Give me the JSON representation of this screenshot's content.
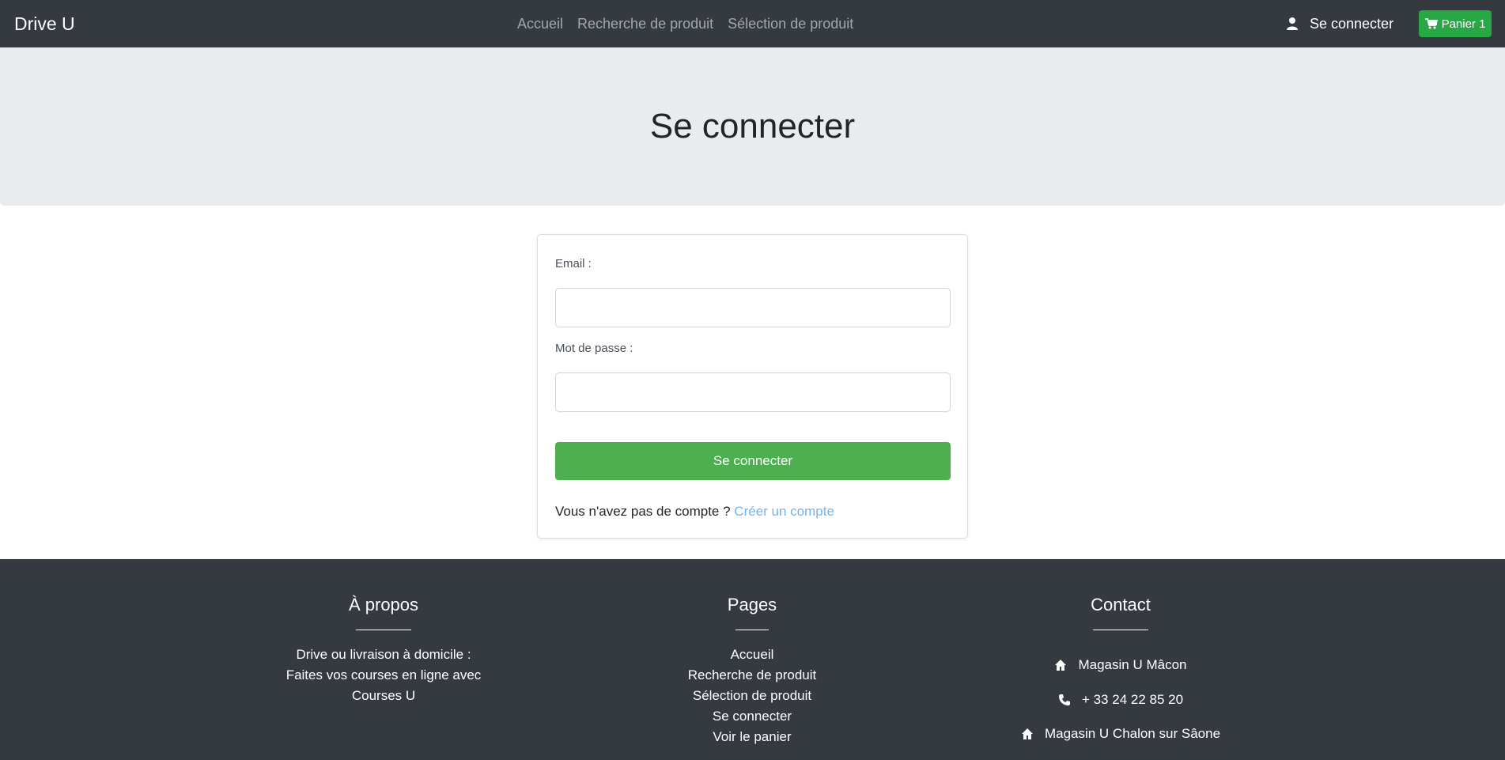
{
  "navbar": {
    "brand": "Drive U",
    "links": [
      "Accueil",
      "Recherche de produit",
      "Sélection de produit"
    ],
    "login_label": "Se connecter",
    "cart_label": "Panier 1"
  },
  "hero": {
    "title": "Se connecter"
  },
  "login_form": {
    "email_label": "Email :",
    "email_value": "",
    "password_label": "Mot de passe :",
    "password_value": "",
    "submit_label": "Se connecter",
    "register_prompt": "Vous n'avez pas de compte ?",
    "register_link": "Créer un compte"
  },
  "footer": {
    "about": {
      "title": "À propos",
      "lines": [
        "Drive ou livraison à domicile :",
        "Faites vos courses en ligne avec",
        "Courses U"
      ]
    },
    "pages": {
      "title": "Pages",
      "links": [
        "Accueil",
        "Recherche de produit",
        "Sélection de produit",
        "Se connecter",
        "Voir le panier"
      ]
    },
    "contact": {
      "title": "Contact",
      "items": [
        {
          "icon": "home-icon",
          "text": "Magasin U Mâcon"
        },
        {
          "icon": "phone-icon",
          "text": "+ 33 24 22 85 20"
        },
        {
          "icon": "home-icon",
          "text": "Magasin U Chalon sur Sâone"
        }
      ]
    }
  },
  "colors": {
    "navbar_bg": "#343a40",
    "jumbotron_bg": "#e9ecef",
    "cart_button": "#28a745",
    "submit_button": "#4caf50",
    "link": "#6fb6f3"
  }
}
